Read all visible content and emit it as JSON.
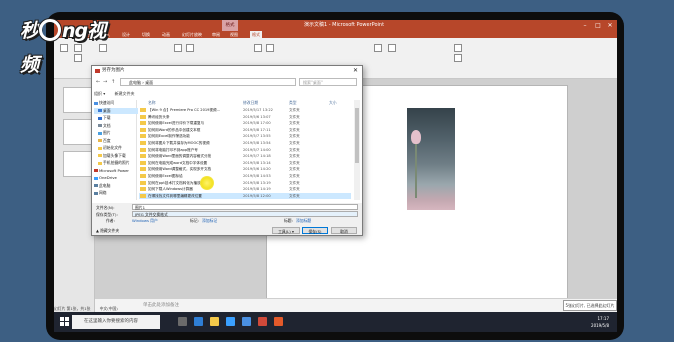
{
  "watermark": {
    "text_a": "秒",
    "text_b": "ng视频"
  },
  "app": {
    "title": "演示文稿1 - Microsoft PowerPoint",
    "context_tab": "格式",
    "tabs": [
      "文件",
      "开始",
      "插入",
      "设计",
      "切换",
      "动画",
      "幻灯片放映",
      "审阅",
      "视图",
      "格式"
    ]
  },
  "dialog": {
    "title": "另存为图片",
    "address": [
      "此电脑",
      "桌面"
    ],
    "search_placeholder": "搜索\"桌面\"",
    "toolbar": {
      "organize": "组织 ▾",
      "new_folder": "新建文件夹"
    },
    "nav_items": [
      "快速访问",
      "桌面",
      "下载",
      "文档",
      "图片",
      "百度",
      "初始化文件",
      "加载头像下载",
      "手机拍摄的照片",
      "Microsoft Power",
      "OneDrive",
      "此电脑",
      "网络"
    ],
    "columns": {
      "name": "名称",
      "date": "修改日期",
      "type": "类型",
      "size": "大小"
    },
    "files": [
      {
        "name": "【Win 9 合】Premiere Pro CC 2019视频...",
        "date": "2019/5/17 13:22",
        "type": "文件夹"
      },
      {
        "name": "腾讯经历头条",
        "date": "2019/5/6 13:07",
        "type": "文件夹"
      },
      {
        "name": "如何使用Excel进行评价下载重复与",
        "date": "2019/5/8 17:00",
        "type": "文件夹"
      },
      {
        "name": "如何用Word的作品中创建文本框",
        "date": "2019/5/8 17:11",
        "type": "文件夹"
      },
      {
        "name": "如何用Excel制作筛选功能",
        "date": "2019/5/7 13:55",
        "type": "文件夹"
      },
      {
        "name": "如何将图片下载并保存为MOOC的视频",
        "date": "2019/5/8 13:54",
        "type": "文件夹"
      },
      {
        "name": "如何将电脑打印不到app账户号",
        "date": "2019/5/7 14:00",
        "type": "文件夹"
      },
      {
        "name": "如何使用Word里面的调整内容格式分批",
        "date": "2019/5/7 14:18",
        "type": "文件夹"
      },
      {
        "name": "如何在电脑完成word文档中字体设置",
        "date": "2019/5/8 13:14",
        "type": "文件夹"
      },
      {
        "name": "如何使用Word调整格式，实现多开文档",
        "date": "2019/5/6 14:20",
        "type": "文件夹"
      },
      {
        "name": "如何使用Excel图标给",
        "date": "2019/5/8 14:53",
        "type": "文件夹"
      },
      {
        "name": "如何在ppt技术打文档转化为播放地址",
        "date": "2019/5/8 13:19",
        "type": "文件夹"
      },
      {
        "name": "如何下载人Windows计算器",
        "date": "2019/5/8 14:19",
        "type": "文件夹"
      },
      {
        "name": "在哪找找文件到哪里编辑更改位置",
        "date": "2019/5/8 12:00",
        "type": "文件夹"
      }
    ],
    "filename_label": "文件名(N):",
    "filename_value": "图片1",
    "filetype_label": "保存类型(T):",
    "filetype_value": "JPEG 文件交换格式",
    "author_label": "作者:",
    "author_value": "Windows 用户",
    "tags_label": "标记:",
    "tags_value": "添加标记",
    "title_label": "标题:",
    "title_value": "添加标题",
    "tools": "工具(L) ▾",
    "save": "保存(S)",
    "cancel": "取消",
    "hide_folders": "▲ 隐藏文件夹"
  },
  "notes": {
    "placeholder": "单击此处添加备注"
  },
  "zoom_tip": "5张幻灯片, 已选择此幻灯片",
  "status": {
    "slide": "幻灯片 第1张，共1张",
    "lang": "中文(中国)"
  },
  "taskbar": {
    "search_placeholder": "在这里输入你要搜索的内容",
    "time": "17:17",
    "date": "2019/5/8"
  }
}
